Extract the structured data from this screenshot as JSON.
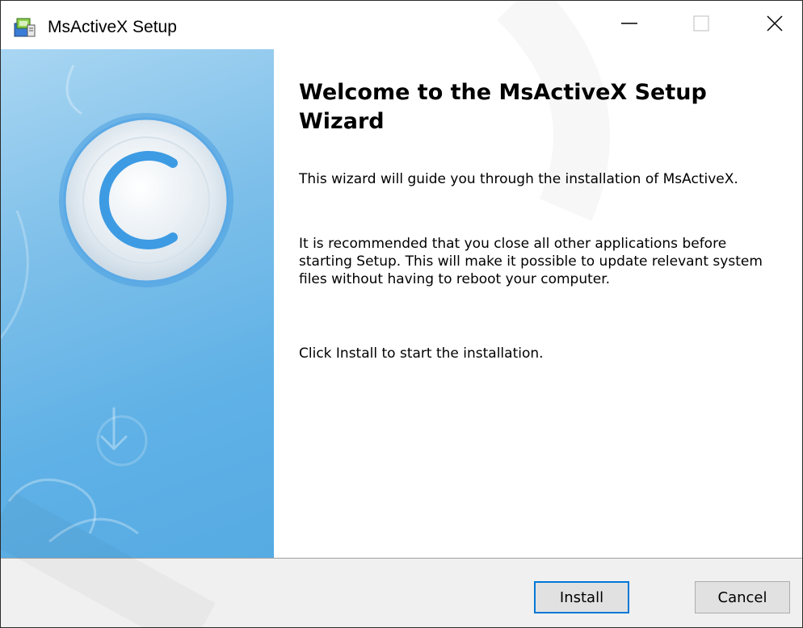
{
  "window": {
    "title": "MsActiveX Setup",
    "controls": {
      "minimize": "minimize",
      "maximize": "maximize",
      "close": "close"
    }
  },
  "welcome": {
    "heading": "Welcome to the MsActiveX Setup Wizard",
    "paragraphs": [
      "This wizard will guide you through the installation of MsActiveX.",
      "It is recommended that you close all other applications before starting Setup. This will make it possible to update relevant system files without having to reboot your computer.",
      "Click Install to start the installation."
    ]
  },
  "buttons": {
    "install": "Install",
    "cancel": "Cancel"
  },
  "icons": {
    "app": "installer-box-icon",
    "banner": "circular-c-logo-icon"
  },
  "colors": {
    "banner_blue": "#5fb1e6",
    "focus_blue": "#0078d7",
    "footer_gray": "#f0f0f0"
  }
}
